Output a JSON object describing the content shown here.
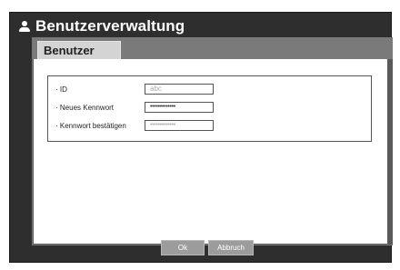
{
  "dialog": {
    "title": "Benutzerverwaltung",
    "icon": "user-icon"
  },
  "tabs": [
    {
      "label": "Benutzer",
      "selected": true
    }
  ],
  "form": {
    "id": {
      "label": "· ID",
      "value": "abc"
    },
    "new_password": {
      "label": "· Neues Kennwort",
      "value": "•••••••••••••"
    },
    "confirm_password": {
      "label": "· Kennwort bestätigen",
      "value": "•••••••••••••"
    }
  },
  "buttons": {
    "ok_label": "Ok",
    "cancel_label": "Abbruch"
  },
  "colors": {
    "window_background": "#2e2e2e",
    "tab_strip": "#7a7a7a",
    "button": "#9c9c9c"
  }
}
